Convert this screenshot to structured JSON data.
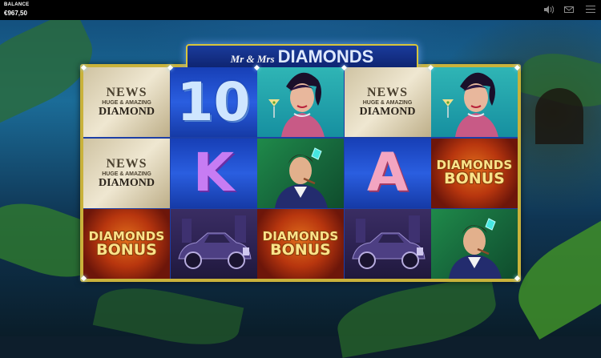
{
  "header": {
    "balance_label": "BALANCE",
    "balance_value": "€967,50",
    "icons": [
      "sound-icon",
      "mail-icon",
      "menu-icon"
    ]
  },
  "logo": {
    "prefix": "Mr & Mrs",
    "name": "DIAMONDS"
  },
  "symbols": {
    "newspaper": {
      "headline": "NEWS",
      "subline": "HUGE & AMAZING",
      "body": "DIAMOND"
    },
    "bonus": {
      "line1": "DIAMONDS",
      "line2": "BONUS"
    },
    "rank_10": "10",
    "rank_k": "K",
    "rank_a": "A"
  },
  "grid": {
    "columns": 5,
    "rows": 3,
    "cells": [
      [
        "newspaper",
        "rank_10",
        "lady",
        "newspaper",
        "lady"
      ],
      [
        "newspaper",
        "rank_k",
        "man",
        "rank_a",
        "bonus"
      ],
      [
        "bonus",
        "car",
        "bonus",
        "car",
        "man"
      ]
    ]
  },
  "colors": {
    "frame": "#c9b23b",
    "reel_bg": "#1f4bc4",
    "topbar": "#000000"
  }
}
